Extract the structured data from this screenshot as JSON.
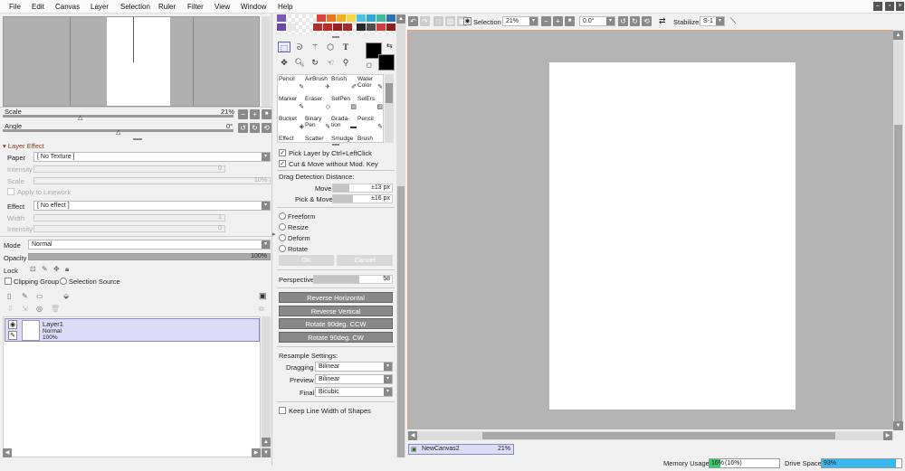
{
  "menu": [
    "File",
    "Edit",
    "Canvas",
    "Layer",
    "Selection",
    "Ruler",
    "Filter",
    "View",
    "Window",
    "Help"
  ],
  "navigator": {
    "scale_label": "Scale",
    "scale_value": "21%",
    "angle_label": "Angle",
    "angle_value": "0°"
  },
  "layer_effect": {
    "header": "Layer Effect",
    "paper_label": "Paper",
    "paper_value": "[ No Texture ]",
    "intensity_label": "Intensity",
    "intensity_value": "0",
    "scale_label": "Scale",
    "scale_value": "10%",
    "apply_label": "Apply to Linework",
    "effect_label": "Effect",
    "effect_value": "[ No effect ]",
    "width_label": "Width",
    "width_value": "1",
    "intensity2_label": "Intensity",
    "intensity2_value": "0"
  },
  "layer_props": {
    "mode_label": "Mode",
    "mode_value": "Normal",
    "opacity_label": "Opacity",
    "opacity_value": "100%",
    "lock_label": "Lock",
    "clipping_label": "Clipping Group",
    "selsource_label": "Selection Source"
  },
  "layer": {
    "name": "Layer1",
    "mode": "Normal",
    "opacity": "100%"
  },
  "brushes": [
    {
      "name": "Pencil",
      "icon": "✎"
    },
    {
      "name": "AirBrush",
      "icon": "✈"
    },
    {
      "name": "Brush",
      "icon": "✐"
    },
    {
      "name": "Water Color",
      "icon": "✎"
    },
    {
      "name": "Marker",
      "icon": "✎"
    },
    {
      "name": "Eraser",
      "icon": "◇"
    },
    {
      "name": "SelPen",
      "icon": "▨"
    },
    {
      "name": "SelErs",
      "icon": "▨"
    },
    {
      "name": "Bucket",
      "icon": "◈"
    },
    {
      "name": "Binary Pen",
      "icon": "✎"
    },
    {
      "name": "Grada-tion",
      "icon": "▬"
    },
    {
      "name": "Pencil",
      "icon": "✎"
    },
    {
      "name": "Effect",
      "icon": ""
    },
    {
      "name": "Scatter",
      "icon": ""
    },
    {
      "name": "Smudge",
      "icon": ""
    },
    {
      "name": "Brush",
      "icon": ""
    }
  ],
  "tool_options": {
    "pick_layer": "Pick Layer by Ctrl+LeftClick",
    "cut_move": "Cut & Move without Mod. Key",
    "drag_label": "Drag Detection Distance:",
    "move_label": "Move",
    "move_value": "±13 px",
    "pickmove_label": "Pick & Move",
    "pickmove_value": "±16 px",
    "freeform": "Freeform",
    "resize": "Resize",
    "deform": "Deform",
    "rotate": "Rotate",
    "ok": "OK",
    "cancel": "Cancel",
    "perspective_label": "Perspective",
    "perspective_value": "58",
    "reverse_h": "Reverse Horizontal",
    "reverse_v": "Reverse Vertical",
    "rot_ccw": "Rotate 90deg. CCW",
    "rot_cw": "Rotate 90deg. CW",
    "resample_label": "Resample Settings:",
    "dragging_label": "Dragging",
    "dragging_value": "Bilinear",
    "preview_label": "Preview",
    "preview_value": "Bilinear",
    "final_label": "Final",
    "final_value": "Bicubic",
    "keep_line": "Keep Line Width of Shapes"
  },
  "canvas_toolbar": {
    "selection_label": "Selection",
    "zoom_value": "21%",
    "angle_value": "0.0°",
    "stabilizer_label": "Stabilizer",
    "stabilizer_value": "S-1"
  },
  "doc_tab": {
    "name": "NewCanvas2",
    "zoom": "21%"
  },
  "status": {
    "memory_label": "Memory Usage",
    "memory_value": "16%",
    "memory_value2": "(16%)",
    "memory_fraction": 0.16,
    "drive_label": "Drive Space",
    "drive_value": "93%",
    "drive_fraction": 0.93
  }
}
